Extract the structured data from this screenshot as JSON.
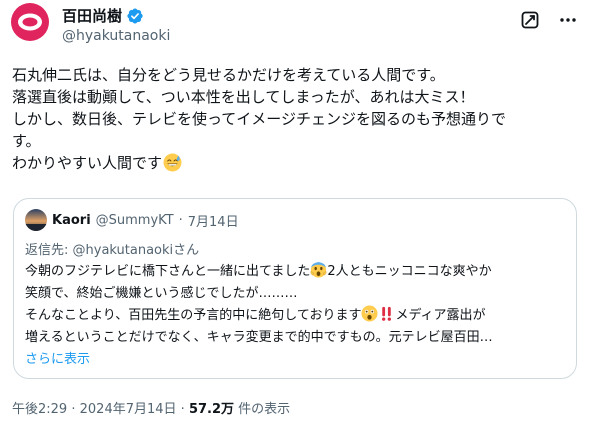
{
  "author": {
    "display_name": "百田尚樹",
    "handle": "@hyakutanaoki",
    "verified": true,
    "avatar_color": "#e0245e"
  },
  "tweet": {
    "lines": [
      "石丸伸二氏は、自分をどう見せるかだけを考えている人間です。",
      "落選直後は動顚して、つい本性を出してしまったが、あれは大ミス！",
      "しかし、数日後、テレビを使ってイメージチェンジを図るのも予想通りで",
      "す。",
      "わかりやすい人間です"
    ],
    "trailing_emoji": "sweat-smile-emoji"
  },
  "quote": {
    "display_name": "Kaori",
    "handle": "@SummyKT",
    "separator": "·",
    "date": "7月14日",
    "reply_prefix": "返信先: ",
    "reply_mention": "@hyakutanaoki",
    "reply_suffix": "さん",
    "line1_a": "今朝のフジテレビに橋下さんと一緒に出てました",
    "line1_b": "2人ともニッコニコな爽やか",
    "line2": "笑顔で、終始ご機嫌という感じでしたが………",
    "line3_a": "そんなことより、百田先生の予言的中に絶句しております",
    "line3_b": "メディア露出が",
    "line4": "増えるということだけでなく、キャラ変更まで的中ですもの。元テレビ屋百田…",
    "show_more": "さらに表示"
  },
  "footer": {
    "time": "午後2:29",
    "separator": "·",
    "date": "2024年7月14日",
    "views_count": "57.2万",
    "views_label": " 件の表示"
  },
  "colors": {
    "verified": "#1d9bf0",
    "link": "#1d9bf0",
    "border": "#cfd9de",
    "muted": "#536471"
  }
}
